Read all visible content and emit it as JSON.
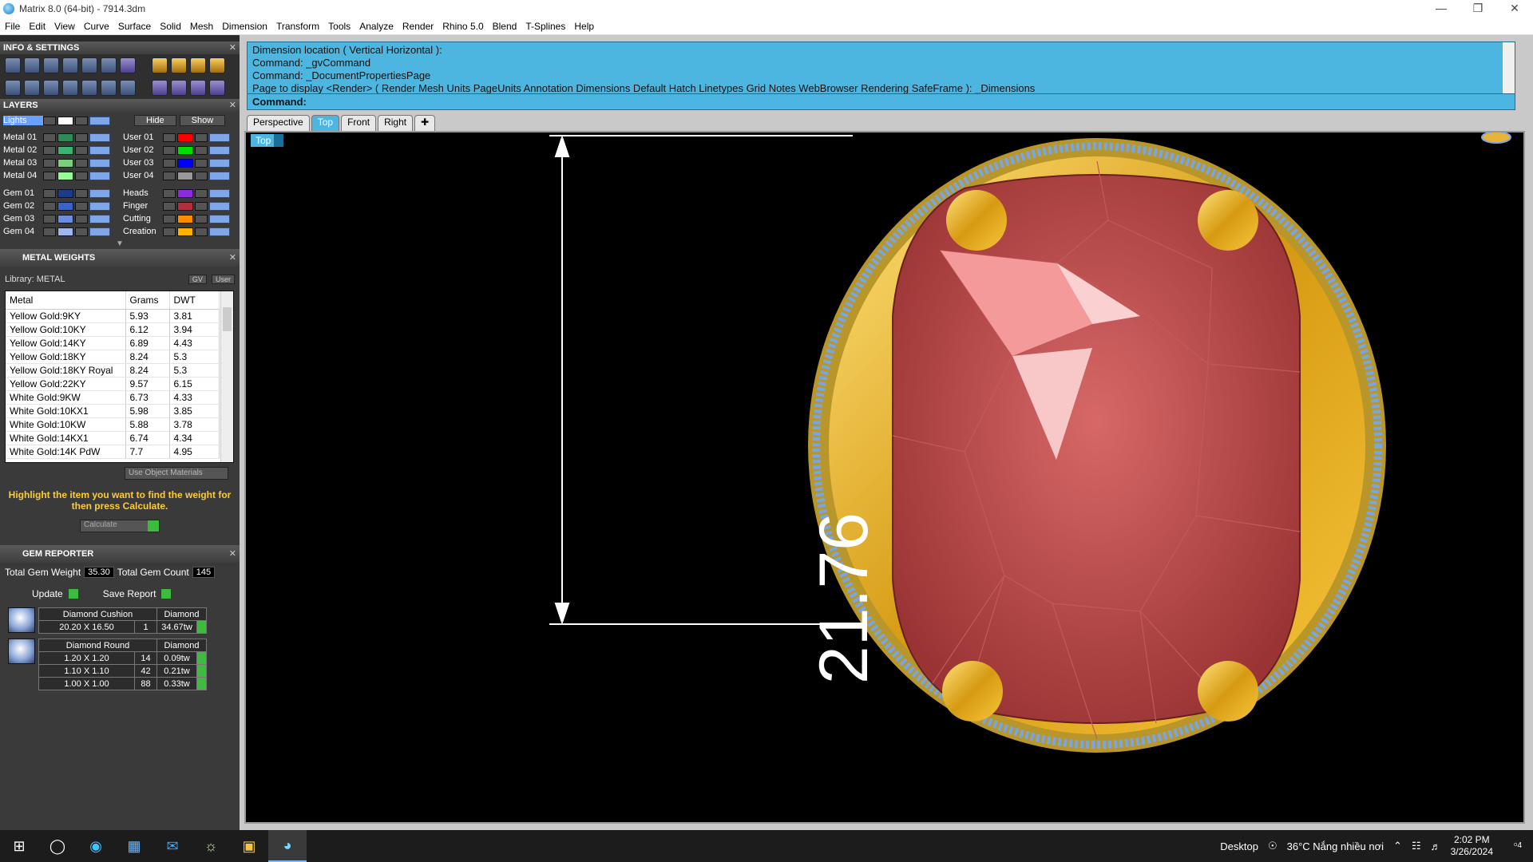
{
  "window": {
    "title": "Matrix 8.0 (64-bit) - 7914.3dm"
  },
  "menu": [
    "File",
    "Edit",
    "View",
    "Curve",
    "Surface",
    "Solid",
    "Mesh",
    "Dimension",
    "Transform",
    "Tools",
    "Analyze",
    "Render",
    "Rhino 5.0",
    "Blend",
    "T-Splines",
    "Help"
  ],
  "panels": {
    "info_settings": "INFO & SETTINGS",
    "layers": "LAYERS",
    "metal_weights": "METAL WEIGHTS",
    "gem_reporter": "GEM REPORTER"
  },
  "layers": {
    "hide_label": "Hide",
    "show_label": "Show",
    "left": [
      {
        "name": "Lights",
        "color": "#ffffff"
      },
      {
        "name": "Metal 01",
        "color": "#2e8b57"
      },
      {
        "name": "Metal 02",
        "color": "#3cb371"
      },
      {
        "name": "Metal 03",
        "color": "#7ccd7c"
      },
      {
        "name": "Metal 04",
        "color": "#98fb98"
      },
      {
        "name": "Gem 01",
        "color": "#1e3a8a"
      },
      {
        "name": "Gem 02",
        "color": "#3b63c7"
      },
      {
        "name": "Gem 03",
        "color": "#6c8ee0"
      },
      {
        "name": "Gem 04",
        "color": "#9fb6ee"
      }
    ],
    "right": [
      {
        "name": "User 01",
        "color": "#ff0000"
      },
      {
        "name": "User 02",
        "color": "#00dd00"
      },
      {
        "name": "User 03",
        "color": "#0000ff"
      },
      {
        "name": "User 04",
        "color": "#999999"
      },
      {
        "name": "Heads",
        "color": "#8a2be2"
      },
      {
        "name": "Finger",
        "color": "#b03040"
      },
      {
        "name": "Cutting",
        "color": "#ff8c00"
      },
      {
        "name": "Creation",
        "color": "#ffb000"
      }
    ]
  },
  "metal_weights": {
    "library": "Library: METAL",
    "btn_gv": "GV",
    "btn_user": "User",
    "columns": [
      "Metal",
      "Grams",
      "DWT"
    ],
    "rows": [
      [
        "Yellow Gold:9KY",
        "5.93",
        "3.81"
      ],
      [
        "Yellow Gold:10KY",
        "6.12",
        "3.94"
      ],
      [
        "Yellow Gold:14KY",
        "6.89",
        "4.43"
      ],
      [
        "Yellow Gold:18KY",
        "8.24",
        "5.3"
      ],
      [
        "Yellow Gold:18KY Royal",
        "8.24",
        "5.3"
      ],
      [
        "Yellow Gold:22KY",
        "9.57",
        "6.15"
      ],
      [
        "White Gold:9KW",
        "6.73",
        "4.33"
      ],
      [
        "White Gold:10KX1",
        "5.98",
        "3.85"
      ],
      [
        "White Gold:10KW",
        "5.88",
        "3.78"
      ],
      [
        "White Gold:14KX1",
        "6.74",
        "4.34"
      ],
      [
        "White Gold:14K PdW",
        "7.7",
        "4.95"
      ]
    ],
    "use_object": "Use Object Materials",
    "hint": "Highlight the item you want to find the weight for then press Calculate.",
    "calculate": "Calculate"
  },
  "gem_reporter": {
    "total_weight_label": "Total Gem Weight",
    "total_weight": "35.30",
    "total_count_label": "Total Gem Count",
    "total_count": "145",
    "update": "Update",
    "save_report": "Save Report",
    "groups": [
      {
        "shape": "Diamond Cushion",
        "material": "Diamond",
        "rows": [
          [
            "20.20 X 16.50",
            "1",
            "34.67tw"
          ]
        ]
      },
      {
        "shape": "Diamond Round",
        "material": "Diamond",
        "rows": [
          [
            "1.20 X 1.20",
            "14",
            "0.09tw"
          ],
          [
            "1.10 X 1.10",
            "42",
            "0.21tw"
          ],
          [
            "1.00 X 1.00",
            "88",
            "0.33tw"
          ]
        ]
      }
    ]
  },
  "command": {
    "lines": [
      "Dimension location ( Vertical  Horizontal ):",
      "Command: _gvCommand",
      "Command: _DocumentPropertiesPage",
      "Page to display <Render> ( Render  Mesh  Units  PageUnits  Annotation  Dimensions  Default  Hatch  Linetypes  Grid  Notes  WebBrowser  Rendering  SafeFrame ): _Dimensions"
    ],
    "prompt": "Command:"
  },
  "tabs": [
    "Perspective",
    "Top",
    "Front",
    "Right"
  ],
  "viewport": {
    "label": "Top",
    "dimension": "21.76"
  },
  "taskbar": {
    "desktop": "Desktop",
    "weather": "36°C  Nắng nhiều nơi",
    "time": "2:02 PM",
    "date": "3/26/2024",
    "notif_count": "4"
  }
}
